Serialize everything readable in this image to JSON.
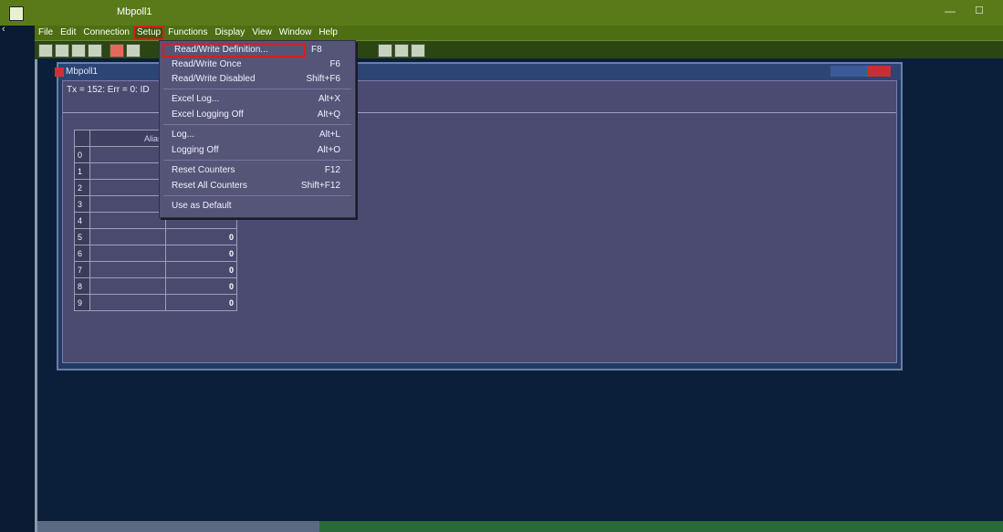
{
  "app": {
    "title": "Mbpoll1"
  },
  "menubar": [
    "File",
    "Edit",
    "Connection",
    "Setup",
    "Functions",
    "Display",
    "View",
    "Window",
    "Help"
  ],
  "child": {
    "title": "Mbpoll1",
    "status": "Tx = 152: Err = 0: ID"
  },
  "grid": {
    "header": "Alias",
    "rows": [
      {
        "index": "0",
        "value": ""
      },
      {
        "index": "1",
        "value": ""
      },
      {
        "index": "2",
        "value": ""
      },
      {
        "index": "3",
        "value": ""
      },
      {
        "index": "4",
        "value": ""
      },
      {
        "index": "5",
        "value": "0"
      },
      {
        "index": "6",
        "value": "0"
      },
      {
        "index": "7",
        "value": "0"
      },
      {
        "index": "8",
        "value": "0"
      },
      {
        "index": "9",
        "value": "0"
      }
    ]
  },
  "setup_menu": {
    "read_write_definition": "Read/Write Definition...",
    "read_write_definition_shortcut": "F8",
    "read_write_once": "Read/Write Once",
    "read_write_once_shortcut": "F6",
    "read_write_disabled": "Read/Write Disabled",
    "read_write_disabled_shortcut": "Shift+F6",
    "excel_log": "Excel Log...",
    "excel_log_shortcut": "Alt+X",
    "excel_logging_off": "Excel Logging Off",
    "excel_logging_off_shortcut": "Alt+Q",
    "log": "Log...",
    "log_shortcut": "Alt+L",
    "logging_off": "Logging Off",
    "logging_off_shortcut": "Alt+O",
    "reset_counters": "Reset Counters",
    "reset_counters_shortcut": "F12",
    "reset_all_counters": "Reset All Counters",
    "reset_all_counters_shortcut": "Shift+F12",
    "use_as_default": "Use as Default"
  },
  "colors": {
    "highlight": "#d81e1e",
    "menu_bg": "#555578",
    "titlebar": "#5a7a1a"
  }
}
